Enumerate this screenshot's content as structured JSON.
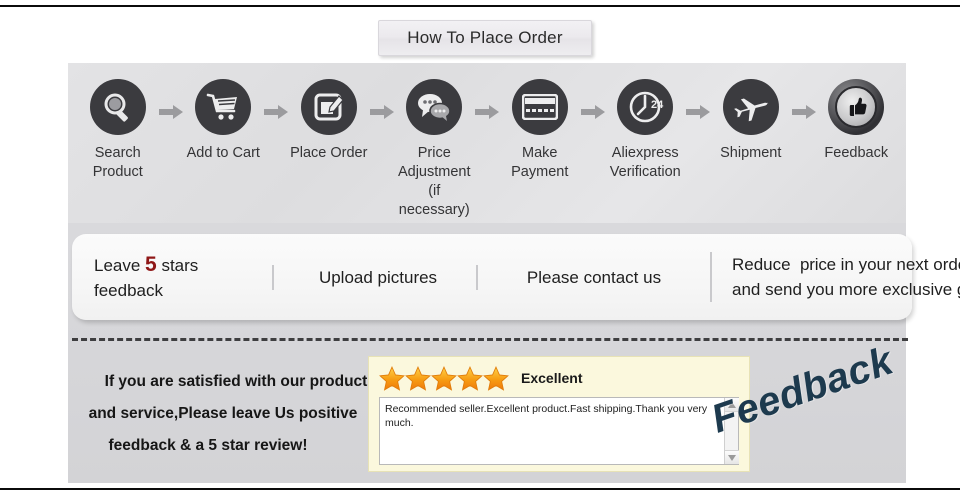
{
  "header": {
    "title": "How To Place Order"
  },
  "steps": [
    {
      "icon": "magnifier-icon",
      "label": "Search\nProduct"
    },
    {
      "icon": "shopping-cart-icon",
      "label": "Add to Cart"
    },
    {
      "icon": "edit-note-icon",
      "label": "Place Order"
    },
    {
      "icon": "chat-bubbles-icon",
      "label": "Price Adjustment\n(if necessary)"
    },
    {
      "icon": "credit-card-icon",
      "label": "Make\nPayment"
    },
    {
      "icon": "clock-24-icon",
      "label": "Aliexpress\nVerification"
    },
    {
      "icon": "airplane-icon",
      "label": "Shipment"
    },
    {
      "icon": "thumbs-up-icon",
      "label": "Feedback"
    }
  ],
  "step_arrow_count": 7,
  "clock_badge": "24",
  "bullets": [
    {
      "pre": "Leave ",
      "highlight": "5",
      "post": " stars\nfeedback"
    },
    {
      "text": "Upload pictures"
    },
    {
      "text": "Please contact us"
    },
    {
      "text": "Reduce  price in your next order\nand send you more exclusive gift"
    }
  ],
  "satisfied": {
    "line1": "If you are satisfied with our product",
    "line2": "and service,Please leave Us positive",
    "line3": "feedback & a 5 star review!"
  },
  "review": {
    "star_count": 5,
    "rating_label": "Excellent",
    "comment": "Recommended seller.Excellent product.Fast shipping.Thank you very much."
  },
  "watermark": {
    "text": "Feedback"
  },
  "colors": {
    "panel_gray": "#d9d9dc",
    "icon_dark": "#3b3b3f",
    "highlight_red": "#8f1717",
    "star_orange": "#f7a31a",
    "review_cream": "#fbf8dd",
    "watermark_navy": "#1d3a4e"
  }
}
